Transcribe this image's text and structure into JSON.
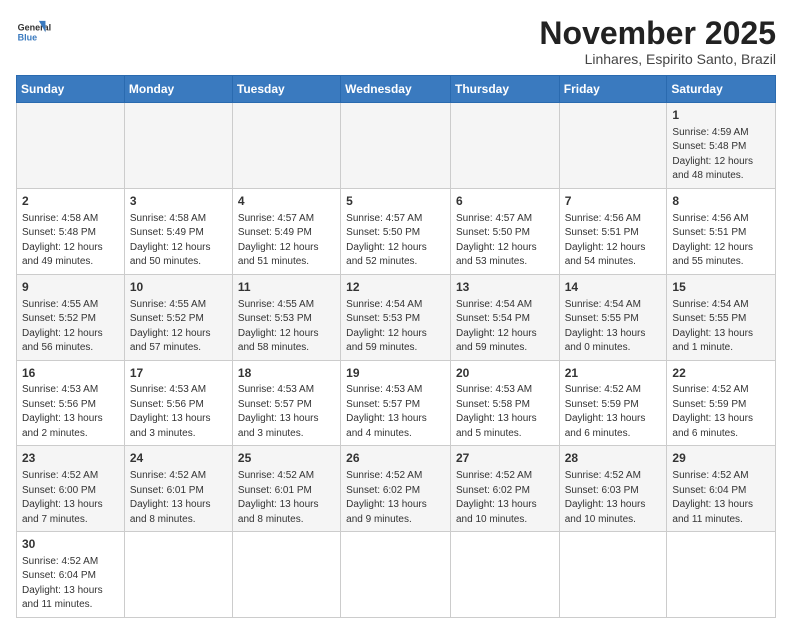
{
  "logo": {
    "line1": "General",
    "line2": "Blue"
  },
  "title": "November 2025",
  "location": "Linhares, Espirito Santo, Brazil",
  "weekdays": [
    "Sunday",
    "Monday",
    "Tuesday",
    "Wednesday",
    "Thursday",
    "Friday",
    "Saturday"
  ],
  "weeks": [
    [
      {
        "day": "",
        "info": ""
      },
      {
        "day": "",
        "info": ""
      },
      {
        "day": "",
        "info": ""
      },
      {
        "day": "",
        "info": ""
      },
      {
        "day": "",
        "info": ""
      },
      {
        "day": "",
        "info": ""
      },
      {
        "day": "1",
        "info": "Sunrise: 4:59 AM\nSunset: 5:48 PM\nDaylight: 12 hours and 48 minutes."
      }
    ],
    [
      {
        "day": "2",
        "info": "Sunrise: 4:58 AM\nSunset: 5:48 PM\nDaylight: 12 hours and 49 minutes."
      },
      {
        "day": "3",
        "info": "Sunrise: 4:58 AM\nSunset: 5:49 PM\nDaylight: 12 hours and 50 minutes."
      },
      {
        "day": "4",
        "info": "Sunrise: 4:57 AM\nSunset: 5:49 PM\nDaylight: 12 hours and 51 minutes."
      },
      {
        "day": "5",
        "info": "Sunrise: 4:57 AM\nSunset: 5:50 PM\nDaylight: 12 hours and 52 minutes."
      },
      {
        "day": "6",
        "info": "Sunrise: 4:57 AM\nSunset: 5:50 PM\nDaylight: 12 hours and 53 minutes."
      },
      {
        "day": "7",
        "info": "Sunrise: 4:56 AM\nSunset: 5:51 PM\nDaylight: 12 hours and 54 minutes."
      },
      {
        "day": "8",
        "info": "Sunrise: 4:56 AM\nSunset: 5:51 PM\nDaylight: 12 hours and 55 minutes."
      }
    ],
    [
      {
        "day": "9",
        "info": "Sunrise: 4:55 AM\nSunset: 5:52 PM\nDaylight: 12 hours and 56 minutes."
      },
      {
        "day": "10",
        "info": "Sunrise: 4:55 AM\nSunset: 5:52 PM\nDaylight: 12 hours and 57 minutes."
      },
      {
        "day": "11",
        "info": "Sunrise: 4:55 AM\nSunset: 5:53 PM\nDaylight: 12 hours and 58 minutes."
      },
      {
        "day": "12",
        "info": "Sunrise: 4:54 AM\nSunset: 5:53 PM\nDaylight: 12 hours and 59 minutes."
      },
      {
        "day": "13",
        "info": "Sunrise: 4:54 AM\nSunset: 5:54 PM\nDaylight: 12 hours and 59 minutes."
      },
      {
        "day": "14",
        "info": "Sunrise: 4:54 AM\nSunset: 5:55 PM\nDaylight: 13 hours and 0 minutes."
      },
      {
        "day": "15",
        "info": "Sunrise: 4:54 AM\nSunset: 5:55 PM\nDaylight: 13 hours and 1 minute."
      }
    ],
    [
      {
        "day": "16",
        "info": "Sunrise: 4:53 AM\nSunset: 5:56 PM\nDaylight: 13 hours and 2 minutes."
      },
      {
        "day": "17",
        "info": "Sunrise: 4:53 AM\nSunset: 5:56 PM\nDaylight: 13 hours and 3 minutes."
      },
      {
        "day": "18",
        "info": "Sunrise: 4:53 AM\nSunset: 5:57 PM\nDaylight: 13 hours and 3 minutes."
      },
      {
        "day": "19",
        "info": "Sunrise: 4:53 AM\nSunset: 5:57 PM\nDaylight: 13 hours and 4 minutes."
      },
      {
        "day": "20",
        "info": "Sunrise: 4:53 AM\nSunset: 5:58 PM\nDaylight: 13 hours and 5 minutes."
      },
      {
        "day": "21",
        "info": "Sunrise: 4:52 AM\nSunset: 5:59 PM\nDaylight: 13 hours and 6 minutes."
      },
      {
        "day": "22",
        "info": "Sunrise: 4:52 AM\nSunset: 5:59 PM\nDaylight: 13 hours and 6 minutes."
      }
    ],
    [
      {
        "day": "23",
        "info": "Sunrise: 4:52 AM\nSunset: 6:00 PM\nDaylight: 13 hours and 7 minutes."
      },
      {
        "day": "24",
        "info": "Sunrise: 4:52 AM\nSunset: 6:01 PM\nDaylight: 13 hours and 8 minutes."
      },
      {
        "day": "25",
        "info": "Sunrise: 4:52 AM\nSunset: 6:01 PM\nDaylight: 13 hours and 8 minutes."
      },
      {
        "day": "26",
        "info": "Sunrise: 4:52 AM\nSunset: 6:02 PM\nDaylight: 13 hours and 9 minutes."
      },
      {
        "day": "27",
        "info": "Sunrise: 4:52 AM\nSunset: 6:02 PM\nDaylight: 13 hours and 10 minutes."
      },
      {
        "day": "28",
        "info": "Sunrise: 4:52 AM\nSunset: 6:03 PM\nDaylight: 13 hours and 10 minutes."
      },
      {
        "day": "29",
        "info": "Sunrise: 4:52 AM\nSunset: 6:04 PM\nDaylight: 13 hours and 11 minutes."
      }
    ],
    [
      {
        "day": "30",
        "info": "Sunrise: 4:52 AM\nSunset: 6:04 PM\nDaylight: 13 hours and 11 minutes."
      },
      {
        "day": "",
        "info": ""
      },
      {
        "day": "",
        "info": ""
      },
      {
        "day": "",
        "info": ""
      },
      {
        "day": "",
        "info": ""
      },
      {
        "day": "",
        "info": ""
      },
      {
        "day": "",
        "info": ""
      }
    ]
  ]
}
